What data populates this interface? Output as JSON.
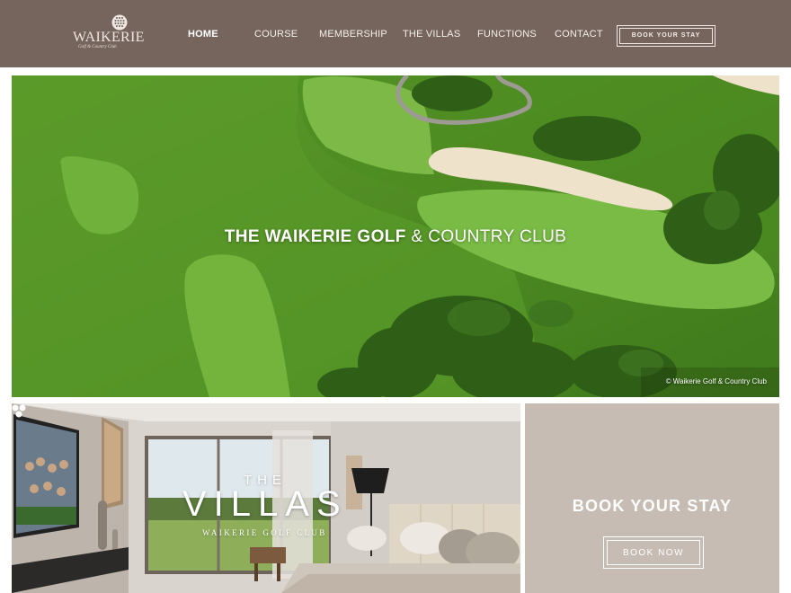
{
  "header": {
    "logo": {
      "name": "WAIKERIE",
      "tagline": "Golf & Country Club"
    },
    "nav": [
      {
        "label": "HOME",
        "active": true
      },
      {
        "label": "COURSE",
        "active": false
      },
      {
        "label": "MEMBERSHIP",
        "active": false
      },
      {
        "label": "THE VILLAS",
        "active": false
      },
      {
        "label": "FUNCTIONS",
        "active": false
      },
      {
        "label": "CONTACT",
        "active": false
      }
    ],
    "book_button": "BOOK YOUR STAY"
  },
  "hero": {
    "title_bold": "THE WAIKERIE GOLF",
    "title_rest": " & COUNTRY CLUB",
    "credit": "© Waikerie Golf & Country Club"
  },
  "villas": {
    "the": "THE",
    "title": "VILLAS",
    "subtitle": "WAIKERIE GOLF CLUB"
  },
  "stay_panel": {
    "title": "BOOK YOUR STAY",
    "button": "BOOK NOW"
  },
  "colors": {
    "header_bg": "#75655c",
    "stay_panel_bg": "#c6bcb3",
    "text_light": "#ffffff"
  },
  "icons": {
    "logo": "golf-ball-icon",
    "villas_logo": "three-dots-icon"
  }
}
